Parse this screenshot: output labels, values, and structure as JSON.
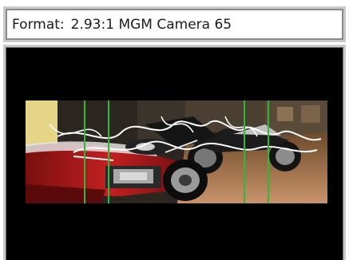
{
  "format_bar": {
    "label": "Format:",
    "value": "2.93:1 MGM Camera 65"
  },
  "preview": {
    "image_name": "motorcycle-showroom-photo",
    "guide_line_color": "#2fb83a",
    "guide_lines": [
      0.195,
      0.275,
      0.725,
      0.805
    ]
  }
}
